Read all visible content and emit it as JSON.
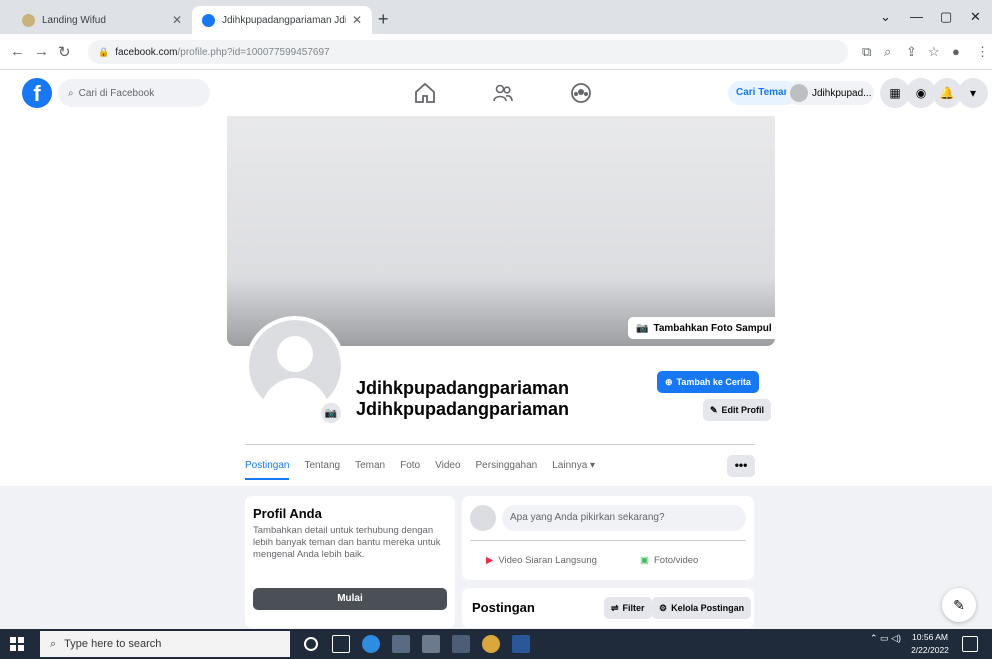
{
  "browser": {
    "tabs": [
      {
        "title": "Landing Wifud",
        "active": false
      },
      {
        "title": "Jdihkpupadangpariaman Jdihkp...",
        "active": true
      }
    ],
    "url_host": "facebook.com",
    "url_path": "/profile.php?id=100077599457697"
  },
  "fb_header": {
    "search_placeholder": "Cari di Facebook",
    "find_friends_label": "Cari Teman",
    "profile_chip_label": "Jdihkpupad..."
  },
  "profile": {
    "add_cover_label": "Tambahkan Foto Sampul",
    "name_line1": "Jdihkpupadangpariaman",
    "name_line2": "Jdihkpupadangpariaman",
    "add_story_label": "Tambah ke Cerita",
    "edit_profile_label": "Edit Profil",
    "tabs": [
      "Postingan",
      "Tentang",
      "Teman",
      "Foto",
      "Video",
      "Persinggahan",
      "Lainnya ▾"
    ],
    "tabs_more_label": "•••"
  },
  "intro": {
    "title": "Profil Anda",
    "description": "Tambahkan detail untuk terhubung dengan lebih banyak teman dan bantu mereka untuk mengenal Anda lebih baik.",
    "button_label": "Mulai"
  },
  "composer": {
    "placeholder": "Apa yang Anda pikirkan sekarang?",
    "live_video_label": "Video Siaran Langsung",
    "photo_video_label": "Foto/video"
  },
  "posts": {
    "title": "Postingan",
    "filter_label": "Filter",
    "manage_label": "Kelola Postingan"
  },
  "taskbar": {
    "search_placeholder": "Type here to search",
    "clock_time": "10:56 AM",
    "clock_date": "2/22/2022"
  },
  "colors": {
    "facebook_blue": "#1877f2",
    "page_background": "#f0f2f5"
  }
}
